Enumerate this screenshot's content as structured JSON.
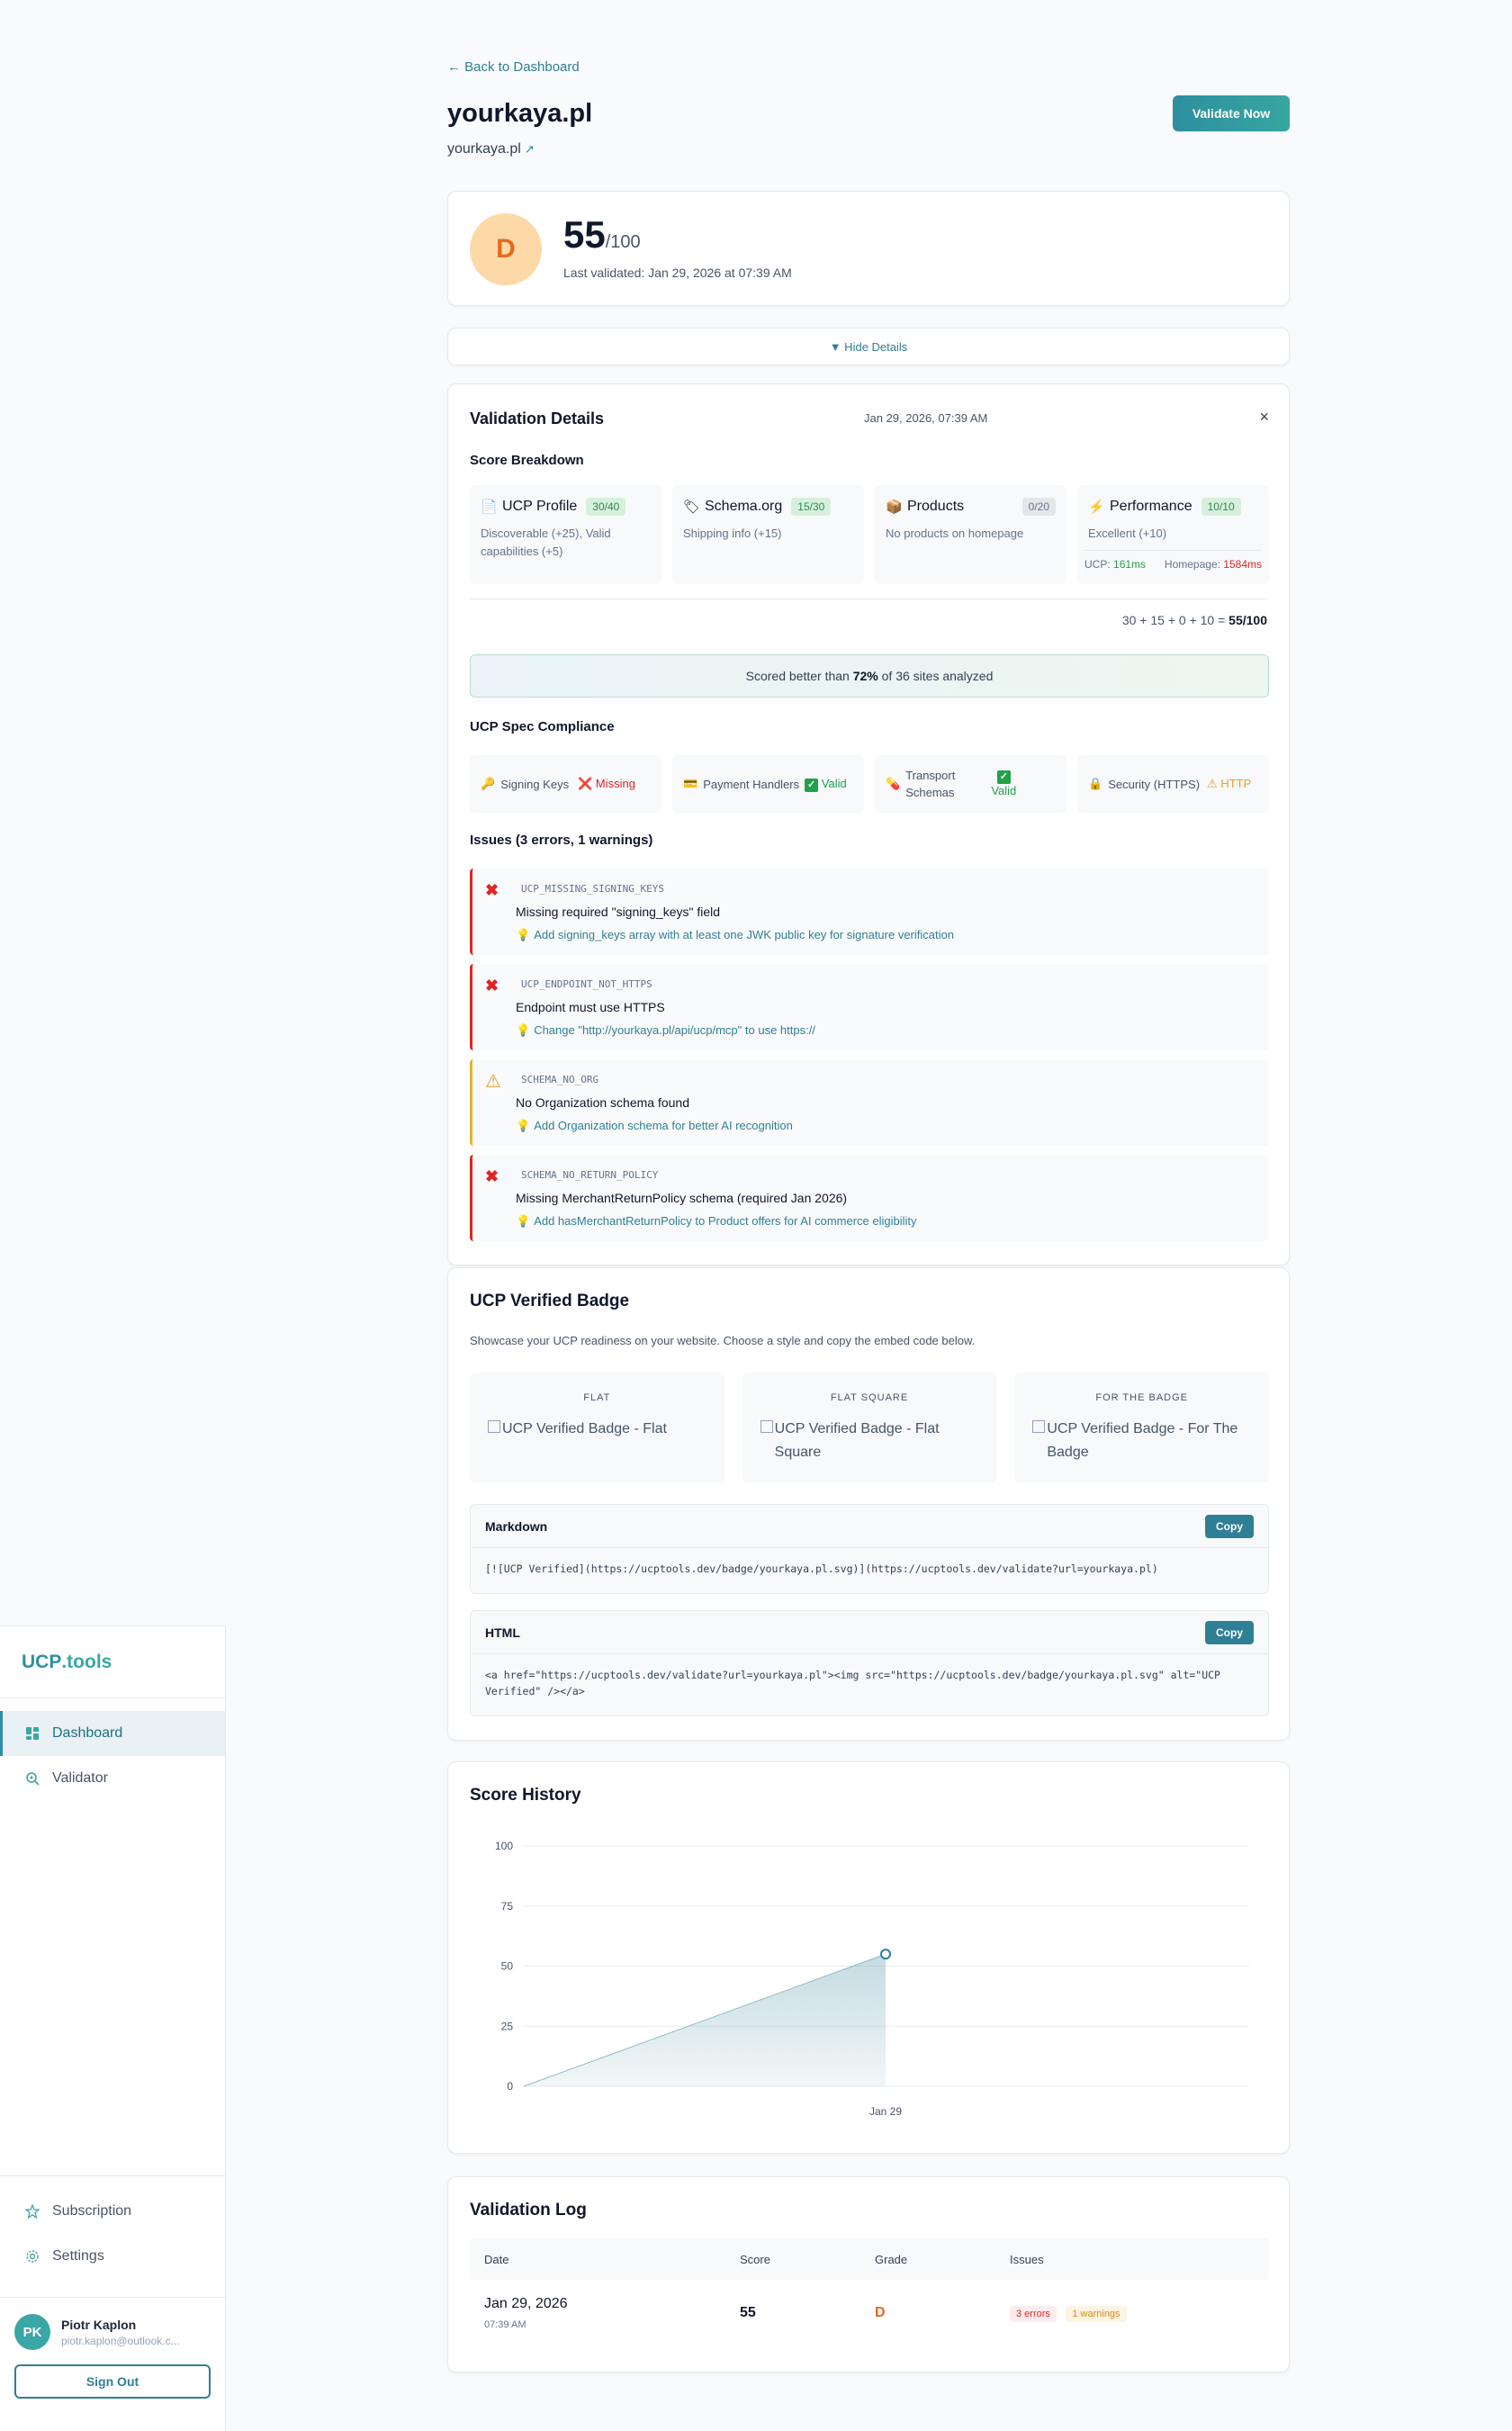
{
  "sidebar": {
    "brand_name": "UCP",
    "brand_tld": ".tools",
    "nav": [
      {
        "label": "Dashboard",
        "icon": "dashboard-icon",
        "active": true
      },
      {
        "label": "Validator",
        "icon": "search-icon",
        "active": false
      }
    ],
    "bottom_nav": [
      {
        "label": "Subscription",
        "icon": "star-icon"
      },
      {
        "label": "Settings",
        "icon": "gear-icon"
      }
    ],
    "user": {
      "initials": "PK",
      "name": "Piotr Kaplon",
      "email": "piotr.kaplon@outlook.c..."
    },
    "sign_out": "Sign Out"
  },
  "header": {
    "back_link": "← Back to Dashboard",
    "title": "yourkaya.pl",
    "site_link": "yourkaya.pl",
    "validate_button": "Validate Now"
  },
  "score": {
    "grade": "D",
    "value": "55",
    "max": "/100",
    "last_validated": "Last validated: Jan 29, 2026 at 07:39 AM"
  },
  "toggle_details": "▼ Hide Details",
  "details": {
    "title": "Validation Details",
    "date": "Jan 29, 2026, 07:39 AM",
    "close": "×",
    "score_breakdown_heading": "Score Breakdown",
    "breakdown": [
      {
        "name": "UCP Profile",
        "icon": "document-icon",
        "score": "30/40",
        "desc": "Discoverable (+25), Valid capabilities (+5)",
        "color": "green"
      },
      {
        "name": "Schema.org",
        "icon": "tag-icon",
        "score": "15/30",
        "desc": "Shipping info (+15)",
        "color": "green"
      },
      {
        "name": "Products",
        "icon": "package-icon",
        "score": "0/20",
        "desc": "No products on homepage",
        "color": "gray"
      },
      {
        "name": "Performance",
        "icon": "lightning-icon",
        "score": "10/10",
        "desc": "Excellent (+10)",
        "color": "green"
      }
    ],
    "performance_ucp_label": "UCP:",
    "performance_ucp_value": "161ms",
    "performance_home_label": "Homepage:",
    "performance_home_value": "1584ms",
    "formula_text": "30 + 15 + 0 + 10  =",
    "formula_total": "55/100",
    "better_pre": "Scored better than",
    "better_pct": "72%",
    "better_post": "of 36 sites analyzed",
    "compliance_heading": "UCP Spec Compliance",
    "compliance": {
      "signing_label": "Signing Keys",
      "signing_status": "Missing",
      "payment_label": "Payment Handlers",
      "payment_status": "Valid",
      "transport_label_1": "Transport",
      "transport_label_2": "Schemas",
      "transport_status": "Valid",
      "security_label": "Security (HTTPS)",
      "security_status": "HTTP"
    },
    "issues_heading": "Issues (3 errors, 1 warnings)",
    "issues": [
      {
        "type": "error",
        "code": "UCP_MISSING_SIGNING_KEYS",
        "message": "Missing required \"signing_keys\" field",
        "fix": "Add signing_keys array with at least one JWK public key for signature verification"
      },
      {
        "type": "error",
        "code": "UCP_ENDPOINT_NOT_HTTPS",
        "message": "Endpoint must use HTTPS",
        "fix": "Change \"http://yourkaya.pl/api/ucp/mcp\" to use https://"
      },
      {
        "type": "warning",
        "code": "SCHEMA_NO_ORG",
        "message": "No Organization schema found",
        "fix": "Add Organization schema for better AI recognition"
      },
      {
        "type": "error",
        "code": "SCHEMA_NO_RETURN_POLICY",
        "message": "Missing MerchantReturnPolicy schema (required Jan 2026)",
        "fix": "Add hasMerchantReturnPolicy to Product offers for AI commerce eligibility"
      }
    ]
  },
  "badge": {
    "title": "UCP Verified Badge",
    "subtitle": "Showcase your UCP readiness on your website. Choose a style and copy the embed code below.",
    "styles": [
      {
        "heading": "FLAT",
        "alt": "UCP Verified Badge - Flat"
      },
      {
        "heading": "FLAT SQUARE",
        "alt": "UCP Verified Badge - Flat Square"
      },
      {
        "heading": "FOR THE BADGE",
        "alt": "UCP Verified Badge - For The Badge"
      }
    ],
    "markdown_label": "Markdown",
    "markdown_code": "[![UCP Verified](https://ucptools.dev/badge/yourkaya.pl.svg)](https://ucptools.dev/validate?url=yourkaya.pl)",
    "html_label": "HTML",
    "html_code": "<a href=\"https://ucptools.dev/validate?url=yourkaya.pl\"><img src=\"https://ucptools.dev/badge/yourkaya.pl.svg\" alt=\"UCP Verified\" /></a>",
    "copy_label": "Copy"
  },
  "history": {
    "title": "Score History"
  },
  "chart_data": {
    "type": "area",
    "title": "Score History",
    "categories": [
      "Jan 29"
    ],
    "values": [
      55
    ],
    "ylim": [
      0,
      100
    ],
    "yticks": [
      0,
      25,
      50,
      75,
      100
    ],
    "grid": true,
    "color": "#2f7f96"
  },
  "log": {
    "title": "Validation Log",
    "headers": [
      "Date",
      "Score",
      "Grade",
      "Issues"
    ],
    "rows": [
      {
        "date": "Jan 29, 2026",
        "time": "07:39 AM",
        "score": "55",
        "grade": "D",
        "errors": "3 errors",
        "warnings": "1 warnings"
      }
    ]
  },
  "colors": {
    "accent": "#2f7f96",
    "grade_d": "#e56a1c",
    "error": "#dc2626",
    "success": "#22a04b",
    "warning": "#e8a02a"
  }
}
